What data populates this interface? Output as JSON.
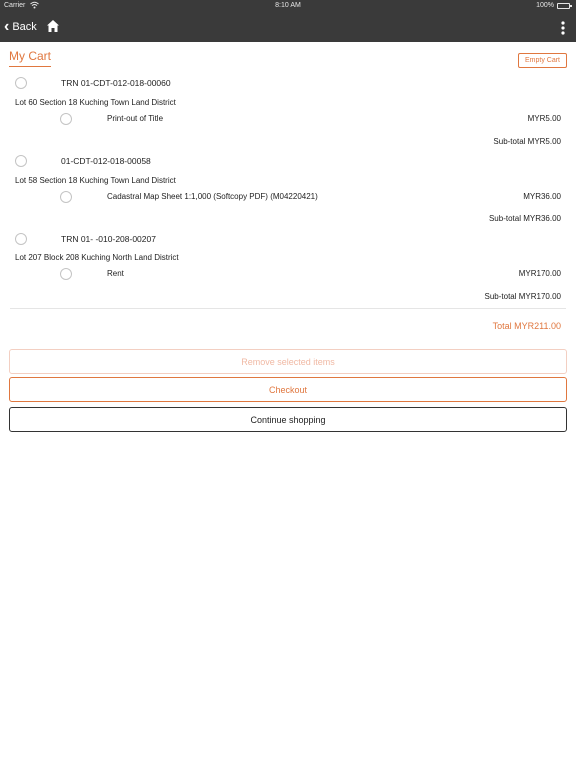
{
  "status_bar": {
    "carrier": "Carrier",
    "time": "8:10 AM",
    "battery": "100%"
  },
  "nav": {
    "back_label": "Back"
  },
  "cart": {
    "title": "My Cart",
    "empty_cart_label": "Empty Cart",
    "groups": [
      {
        "reference": "TRN 01-CDT-012-018-00060",
        "location": "Lot 60 Section 18 Kuching Town Land District",
        "item": {
          "name": "Print-out of Title",
          "price": "MYR5.00"
        },
        "subtotal": "Sub-total MYR5.00"
      },
      {
        "reference": "01-CDT-012-018-00058",
        "location": "Lot 58 Section 18 Kuching Town Land District",
        "item": {
          "name": "Cadastral Map Sheet 1:1,000 (Softcopy PDF) (M04220421)",
          "price": "MYR36.00"
        },
        "subtotal": "Sub-total MYR36.00"
      },
      {
        "reference": "TRN 01- -010-208-00207",
        "location": "Lot 207 Block 208 Kuching North Land District",
        "item": {
          "name": "Rent",
          "price": "MYR170.00"
        },
        "subtotal": "Sub-total MYR170.00"
      }
    ],
    "total": "Total MYR211.00"
  },
  "actions": {
    "remove_label": "Remove selected items",
    "checkout_label": "Checkout",
    "continue_label": "Continue shopping"
  },
  "colors": {
    "accent": "#e0773f",
    "nav_background": "#3a3a3a"
  }
}
